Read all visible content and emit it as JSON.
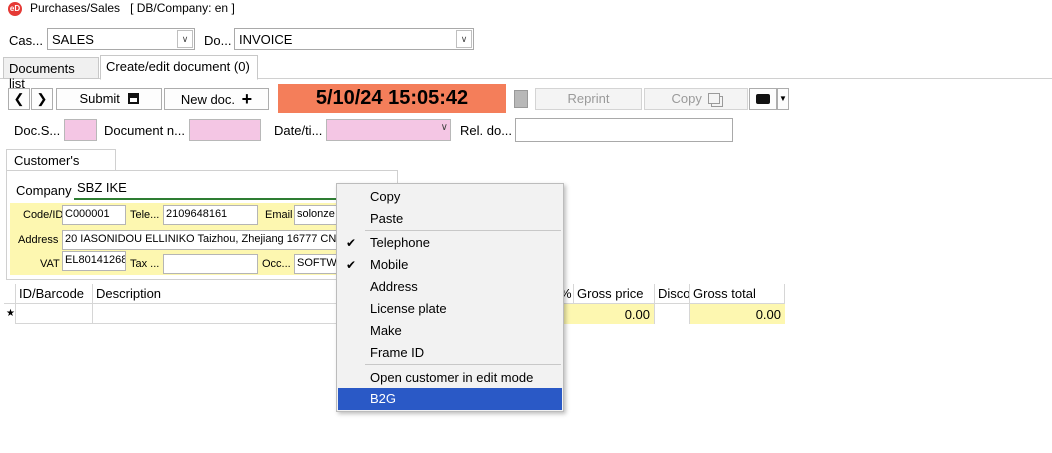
{
  "window": {
    "title": "Purchases/Sales",
    "db_company": "[ DB/Company: en ]",
    "icon_text": "eD"
  },
  "filters": {
    "case_label": "Cas...",
    "case_value": "SALES",
    "doc_label": "Do...",
    "doc_value": "INVOICE"
  },
  "tabs": [
    {
      "label": "Documents list"
    },
    {
      "label": "Create/edit document (0)"
    }
  ],
  "toolbar": {
    "submit_label": "Submit",
    "new_doc_label": "New doc.",
    "clock": "5/10/24 15:05:42",
    "reprint_label": "Reprint",
    "copy_label": "Copy"
  },
  "header_fields": {
    "doc_series_label": "Doc.S...",
    "doc_number_label": "Document n...",
    "date_label": "Date/ti...",
    "rel_doc_label": "Rel. do..."
  },
  "customer": {
    "group_label": "Customer's data",
    "company_label": "Company",
    "company_value": "SBZ IKE",
    "code_label": "Code/ID",
    "code_value": "C000001",
    "tele_label": "Tele...",
    "tele_value": "2109648161",
    "email_label": "Email",
    "email_value": "solonze",
    "address_label": "Address",
    "address_value": "20 IASONIDOU ELLINIKO Taizhou, Zhejiang 16777 CN",
    "vat_label": "VAT",
    "vat_value": "EL80141268",
    "tax_label": "Tax ...",
    "tax_value": "",
    "occ_label": "Occ...",
    "occ_value": "SOFTW."
  },
  "grid": {
    "columns": [
      "ID/Barcode",
      "Description",
      "%",
      "Gross price",
      "Disco",
      "Gross total"
    ],
    "new_row_marker": "★",
    "gross_price": "0.00",
    "gross_total": "0.00"
  },
  "context_menu": {
    "items": [
      {
        "label": "Copy",
        "checked": false
      },
      {
        "label": "Paste",
        "checked": false
      },
      {
        "label": "Telephone",
        "checked": true
      },
      {
        "label": "Mobile",
        "checked": true
      },
      {
        "label": "Address",
        "checked": false
      },
      {
        "label": "License plate",
        "checked": false
      },
      {
        "label": "Make",
        "checked": false
      },
      {
        "label": "Frame ID",
        "checked": false
      },
      {
        "label": "Open customer in edit mode",
        "checked": false
      },
      {
        "label": "B2G",
        "checked": false,
        "highlighted": true
      }
    ],
    "check_glyph": "✔"
  },
  "colors": {
    "clock_bg": "#f47e5a",
    "pink_field": "#f4c6e4",
    "yellow_area": "#fdf7b0",
    "menu_highlight": "#2a59c6"
  }
}
